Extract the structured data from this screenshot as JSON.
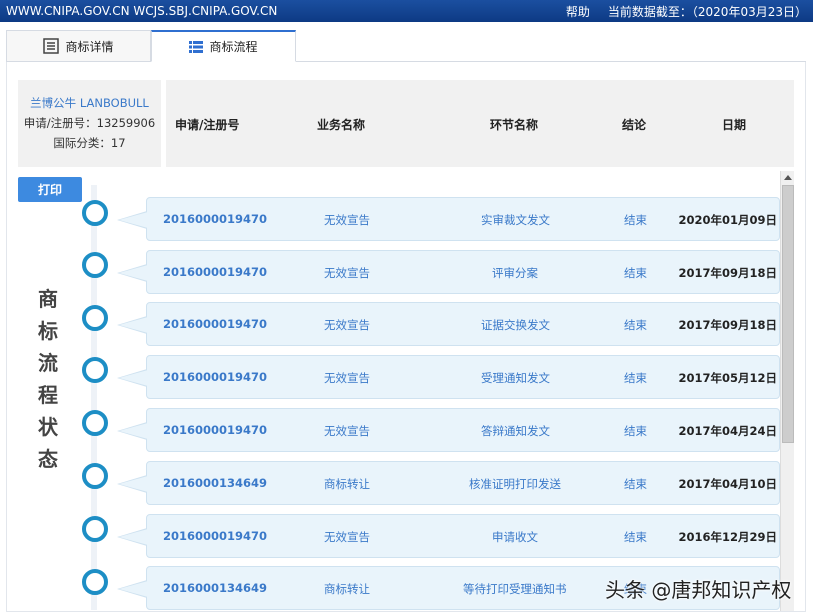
{
  "topbar": {
    "left": "WWW.CNIPA.GOV.CN WCJS.SBJ.CNIPA.GOV.CN",
    "help": "帮助",
    "date_label": "当前数据截至：（2020年03月23日）"
  },
  "tabs": [
    {
      "label": "商标详情",
      "icon": "document-icon"
    },
    {
      "label": "商标流程",
      "icon": "list-icon"
    }
  ],
  "info": {
    "name": "兰博公牛 LANBOBULL",
    "reg": "申请/注册号：13259906",
    "class": "国际分类：17"
  },
  "columns": [
    "申请/注册号",
    "业务名称",
    "环节名称",
    "结论",
    "日期"
  ],
  "print_label": "打印",
  "vertical_title": [
    "商",
    "标",
    "流",
    "程",
    "状",
    "态"
  ],
  "rows": [
    {
      "no": "2016000019470",
      "biz": "无效宣告",
      "step": "实审裁文发文",
      "result": "结束",
      "date": "2020年01月09日"
    },
    {
      "no": "2016000019470",
      "biz": "无效宣告",
      "step": "评审分案",
      "result": "结束",
      "date": "2017年09月18日"
    },
    {
      "no": "2016000019470",
      "biz": "无效宣告",
      "step": "证据交换发文",
      "result": "结束",
      "date": "2017年09月18日"
    },
    {
      "no": "2016000019470",
      "biz": "无效宣告",
      "step": "受理通知发文",
      "result": "结束",
      "date": "2017年05月12日"
    },
    {
      "no": "2016000019470",
      "biz": "无效宣告",
      "step": "答辩通知发文",
      "result": "结束",
      "date": "2017年04月24日"
    },
    {
      "no": "2016000134649",
      "biz": "商标转让",
      "step": "核准证明打印发送",
      "result": "结束",
      "date": "2017年04月10日"
    },
    {
      "no": "2016000019470",
      "biz": "无效宣告",
      "step": "申请收文",
      "result": "结束",
      "date": "2016年12月29日"
    },
    {
      "no": "2016000134649",
      "biz": "商标转让",
      "step": "等待打印受理通知书",
      "result": "结束",
      "date": ""
    }
  ],
  "watermark": "头条 @唐邦知识产权"
}
